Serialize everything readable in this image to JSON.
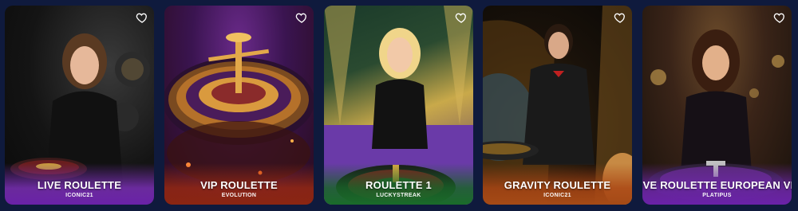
{
  "games": [
    {
      "title": "LIVE ROULETTE",
      "provider": "ICONIC21",
      "accent": "#7a2fb5"
    },
    {
      "title": "VIP ROULETTE",
      "provider": "EVOLUTION",
      "accent": "#b3341c"
    },
    {
      "title": "ROULETTE 1",
      "provider": "LUCKYSTREAK",
      "accent": "#1f7a2e"
    },
    {
      "title": "GRAVITY ROULETTE",
      "provider": "ICONIC21",
      "accent": "#c2571b"
    },
    {
      "title": "LIVE ROULETTE EUROPEAN VIP",
      "provider": "PLATIPUS",
      "accent": "#7a2fb5"
    }
  ],
  "icons": {
    "favorite": "heart-outline-icon"
  },
  "colors": {
    "page_background": "#0f1a3d",
    "text": "#ffffff"
  }
}
